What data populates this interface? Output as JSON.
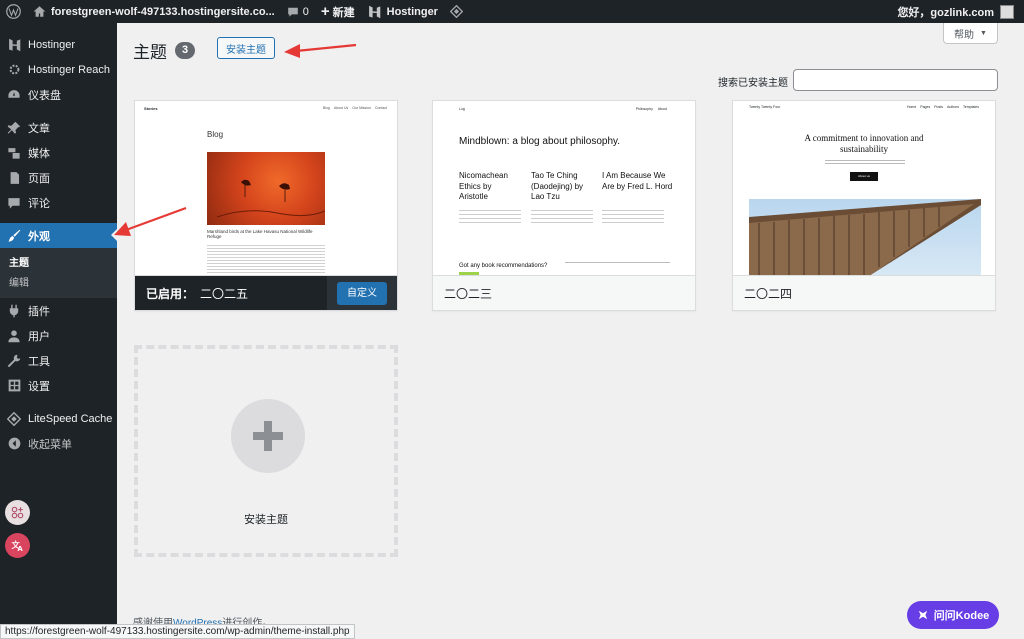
{
  "adminbar": {
    "site_name": "forestgreen-wolf-497133.hostingersite.co...",
    "comments_count": "0",
    "new_label": "新建",
    "hostinger_label": "Hostinger",
    "greeting": "您好，gozlink.com"
  },
  "sidebar": {
    "items": [
      {
        "label": "Hostinger",
        "icon": "hostinger-icon"
      },
      {
        "label": "Hostinger Reach",
        "icon": "gear-icon"
      },
      {
        "label": "仪表盘",
        "icon": "dashboard-icon"
      },
      {
        "label": "文章",
        "icon": "pin-icon"
      },
      {
        "label": "媒体",
        "icon": "media-icon"
      },
      {
        "label": "页面",
        "icon": "page-icon"
      },
      {
        "label": "评论",
        "icon": "comment-icon"
      },
      {
        "label": "外观",
        "icon": "brush-icon"
      },
      {
        "label": "插件",
        "icon": "plugin-icon"
      },
      {
        "label": "用户",
        "icon": "user-icon"
      },
      {
        "label": "工具",
        "icon": "wrench-icon"
      },
      {
        "label": "设置",
        "icon": "settings-icon"
      },
      {
        "label": "LiteSpeed Cache",
        "icon": "litespeed-icon"
      },
      {
        "label": "收起菜单",
        "icon": "collapse-icon"
      }
    ],
    "submenu": [
      "主题",
      "编辑"
    ]
  },
  "header": {
    "title": "主题",
    "count": "3",
    "add_button": "安装主题",
    "help_button": "帮助",
    "search_label": "搜索已安装主题",
    "search_value": ""
  },
  "themes": [
    {
      "name": "二〇二五",
      "active_prefix": "已启用：",
      "customize_label": "自定义",
      "preview": {
        "site": "Stories",
        "nav": [
          "Blog",
          "About Us",
          "Our Mission",
          "Contact"
        ],
        "heading": "Blog",
        "caption": "Marshland birds at the Lake Havasu National Wildlife Refuge"
      }
    },
    {
      "name": "二〇二三",
      "preview": {
        "site": "Log",
        "nav": [
          "Philosophy",
          "About"
        ],
        "heading": "Mindblown: a blog about philosophy.",
        "posts": [
          "Nicomachean Ethics by Aristotle",
          "Tao Te Ching (Daodejing) by Lao Tzu",
          "I Am Because We Are by Fred L. Hord"
        ],
        "footer_question": "Got any book recommendations?"
      }
    },
    {
      "name": "二〇二四",
      "preview": {
        "site": "Twenty Twenty Four",
        "nav": [
          "Home",
          "Pages",
          "Posts",
          "Authors",
          "Templates"
        ],
        "heading": "A commitment to innovation and sustainability",
        "button": "About us"
      }
    }
  ],
  "add_new_card": {
    "label": "安装主题"
  },
  "footer": {
    "prefix": "感谢使用",
    "link": "WordPress",
    "suffix": "进行创作。"
  },
  "status_url": "https://forestgreen-wolf-497133.hostingersite.com/wp-admin/theme-install.php",
  "kodee_button": "问问Kodee",
  "colors": {
    "admin_dark": "#1d2327",
    "accent_blue": "#2271b1",
    "kodee_purple": "#673de6",
    "arrow_red": "#e53935"
  }
}
